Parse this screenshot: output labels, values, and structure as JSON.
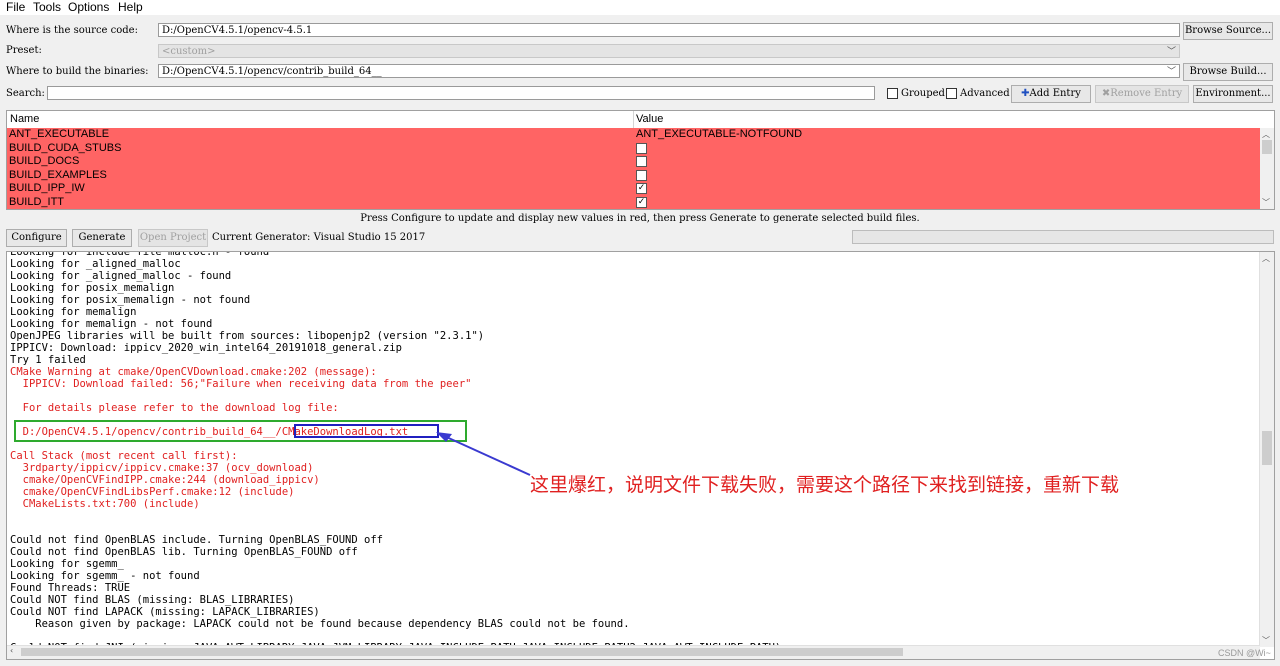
{
  "menu": [
    "File",
    "Tools",
    "Options",
    "Help"
  ],
  "source": {
    "label": "Where is the source code:",
    "value": "D:/OpenCV4.5.1/opencv-4.5.1",
    "button": "Browse Source..."
  },
  "preset": {
    "label": "Preset:",
    "value": "<custom>"
  },
  "build": {
    "label": "Where to build the binaries:",
    "value": "D:/OpenCV4.5.1/opencv/contrib_build_64__",
    "button": "Browse Build..."
  },
  "search": {
    "label": "Search:",
    "value": ""
  },
  "options": {
    "grouped": "Grouped",
    "advanced": "Advanced",
    "add_entry": "Add Entry",
    "remove_entry": "Remove Entry",
    "environment": "Environment..."
  },
  "table": {
    "headers": [
      "Name",
      "Value"
    ],
    "rows": [
      {
        "name": "ANT_EXECUTABLE",
        "value": "ANT_EXECUTABLE-NOTFOUND"
      },
      {
        "name": "BUILD_CUDA_STUBS",
        "checked": false
      },
      {
        "name": "BUILD_DOCS",
        "checked": false
      },
      {
        "name": "BUILD_EXAMPLES",
        "checked": false
      },
      {
        "name": "BUILD_IPP_IW",
        "checked": true
      },
      {
        "name": "BUILD_ITT",
        "checked": true
      }
    ]
  },
  "hint": "Press Configure to update and display new values in red, then press Generate to generate selected build files.",
  "actions": {
    "configure": "Configure",
    "generate": "Generate",
    "open_project": "Open Project",
    "generator": "Current Generator: Visual Studio 15 2017"
  },
  "log": [
    {
      "text": "Looking for include file malloc.h - found",
      "red": false
    },
    {
      "text": "Looking for _aligned_malloc",
      "red": false
    },
    {
      "text": "Looking for _aligned_malloc - found",
      "red": false
    },
    {
      "text": "Looking for posix_memalign",
      "red": false
    },
    {
      "text": "Looking for posix_memalign - not found",
      "red": false
    },
    {
      "text": "Looking for memalign",
      "red": false
    },
    {
      "text": "Looking for memalign - not found",
      "red": false
    },
    {
      "text": "OpenJPEG libraries will be built from sources: libopenjp2 (version \"2.3.1\")",
      "red": false
    },
    {
      "text": "IPPICV: Download: ippicv_2020_win_intel64_20191018_general.zip",
      "red": false
    },
    {
      "text": "Try 1 failed",
      "red": false
    },
    {
      "text": "CMake Warning at cmake/OpenCVDownload.cmake:202 (message):",
      "red": true
    },
    {
      "text": "  IPPICV: Download failed: 56;\"Failure when receiving data from the peer\"",
      "red": true
    },
    {
      "text": "",
      "red": false
    },
    {
      "text": "  For details please refer to the download log file:",
      "red": true
    },
    {
      "text": "",
      "red": false
    },
    {
      "text": "  D:/OpenCV4.5.1/opencv/contrib_build_64__/CMakeDownloadLog.txt",
      "red": true
    },
    {
      "text": "",
      "red": false
    },
    {
      "text": "Call Stack (most recent call first):",
      "red": true
    },
    {
      "text": "  3rdparty/ippicv/ippicv.cmake:37 (ocv_download)",
      "red": true
    },
    {
      "text": "  cmake/OpenCVFindIPP.cmake:244 (download_ippicv)",
      "red": true
    },
    {
      "text": "  cmake/OpenCVFindLibsPerf.cmake:12 (include)",
      "red": true
    },
    {
      "text": "  CMakeLists.txt:700 (include)",
      "red": true
    },
    {
      "text": "",
      "red": false
    },
    {
      "text": "",
      "red": false
    },
    {
      "text": "Could not find OpenBLAS include. Turning OpenBLAS_FOUND off",
      "red": false
    },
    {
      "text": "Could not find OpenBLAS lib. Turning OpenBLAS_FOUND off",
      "red": false
    },
    {
      "text": "Looking for sgemm_",
      "red": false
    },
    {
      "text": "Looking for sgemm_ - not found",
      "red": false
    },
    {
      "text": "Found Threads: TRUE",
      "red": false
    },
    {
      "text": "Could NOT find BLAS (missing: BLAS_LIBRARIES)",
      "red": false
    },
    {
      "text": "Could NOT find LAPACK (missing: LAPACK_LIBRARIES)",
      "red": false
    },
    {
      "text": "    Reason given by package: LAPACK could not be found because dependency BLAS could not be found.",
      "red": false
    },
    {
      "text": "",
      "red": false
    },
    {
      "text": "Could NOT find JNI (missing: JAVA_AWT_LIBRARY JAVA_JVM_LIBRARY JAVA_INCLUDE_PATH JAVA_INCLUDE_PATH2 JAVA_AWT_INCLUDE_PATH)",
      "red": false
    }
  ],
  "annotation": "这里爆红，说明文件下载失败，需要这个路径下来找到链接，重新下载",
  "watermark": "CSDN @Wi~",
  "colors": {
    "error_row": "#ff6464",
    "log_red": "#e02020",
    "highlight_green": "#2eaa2e",
    "highlight_blue": "#2020c0",
    "arrow": "#3a3ad0"
  }
}
